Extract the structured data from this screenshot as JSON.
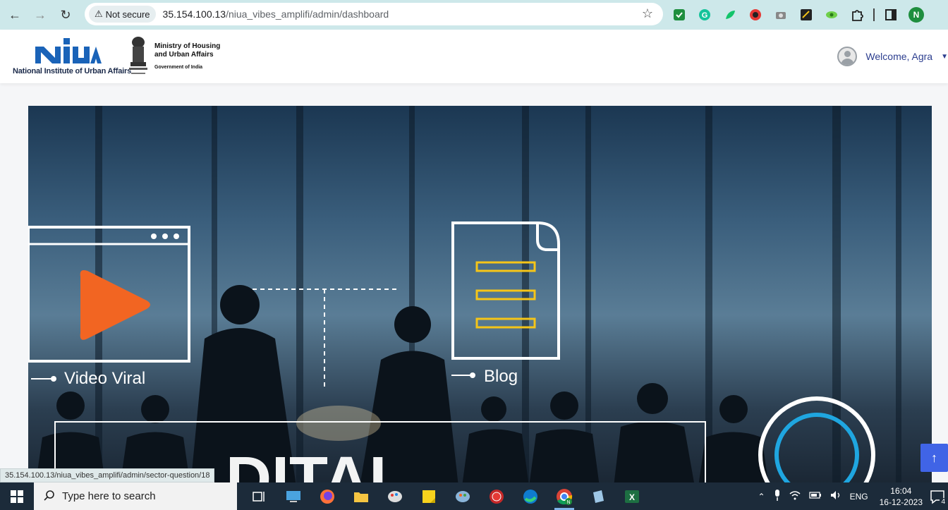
{
  "browser": {
    "security_label": "Not secure",
    "url_host": "35.154.100.13",
    "url_path": "/niua_vibes_amplifi/admin/dashboard",
    "profile_initial": "N"
  },
  "header": {
    "org_name": "National Institute of Urban Affairs",
    "ministry_line1": "Ministry of Housing",
    "ministry_line2": "and Urban Affairs",
    "ministry_line3": "Government of India",
    "welcome_text": "Welcome, Agra"
  },
  "hero": {
    "label_video": "Video Viral",
    "label_blog": "Blog",
    "colors": {
      "play": "#f26522",
      "doc_lines": "#f5c518",
      "ring": "#1fa6e0"
    }
  },
  "status_url": "35.154.100.13/niua_vibes_amplifi/admin/sector-question/18",
  "taskbar": {
    "search_placeholder": "Type here to search",
    "language": "ENG",
    "time": "16:04",
    "date": "16-12-2023",
    "notification_count": "4"
  }
}
